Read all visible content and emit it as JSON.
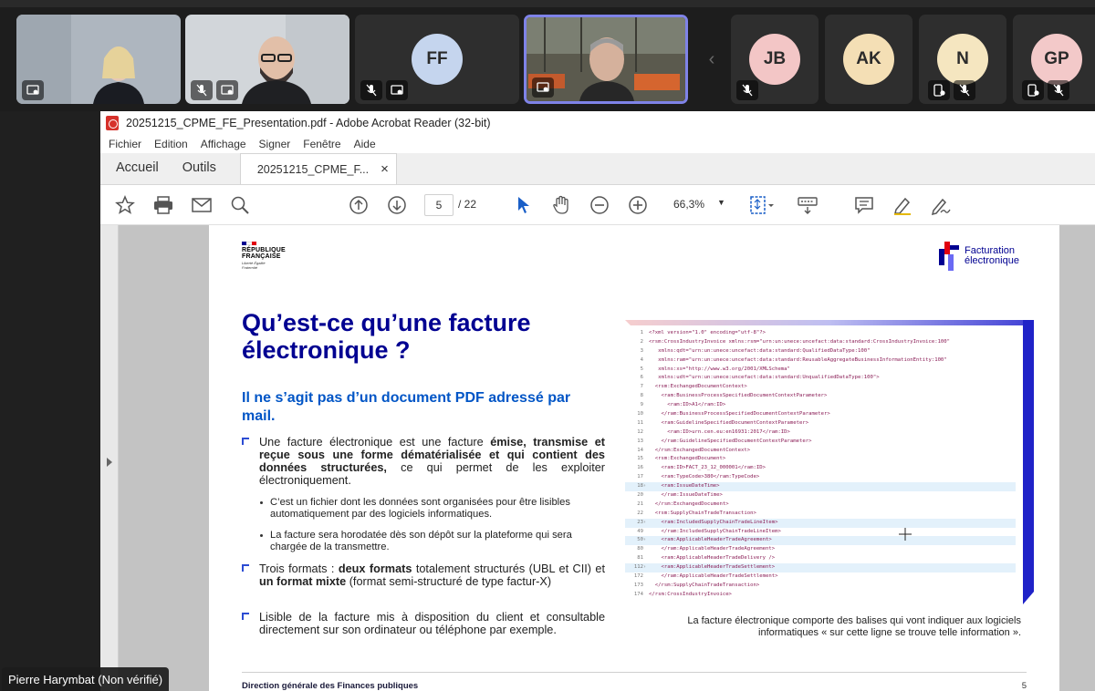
{
  "participants": [
    {
      "kind": "video",
      "label": "",
      "avatar_bg": "#b9c0c8"
    },
    {
      "kind": "video",
      "label": "",
      "avatar_bg": "#cfd3d8"
    },
    {
      "kind": "avatar",
      "label": "FF",
      "avatar_bg": "#c5d5ee"
    },
    {
      "kind": "video-active",
      "label": "",
      "avatar_bg": "#6b6250"
    },
    {
      "kind": "avatar",
      "label": "JB",
      "avatar_bg": "#f3c6c6"
    },
    {
      "kind": "avatar",
      "label": "AK",
      "avatar_bg": "#f4dfb5"
    },
    {
      "kind": "avatar",
      "label": "N",
      "avatar_bg": "#f5e6c0"
    },
    {
      "kind": "avatar",
      "label": "GP",
      "avatar_bg": "#f3c9c9"
    }
  ],
  "speaker_name": "Pierre Harymbat (Non vérifié)",
  "acrobat": {
    "window_title": "20251215_CPME_FE_Presentation.pdf - Adobe Acrobat Reader (32-bit)",
    "menu": [
      "Fichier",
      "Edition",
      "Affichage",
      "Signer",
      "Fenêtre",
      "Aide"
    ],
    "tabs": {
      "home": "Accueil",
      "tools": "Outils",
      "doc": "20251215_CPME_F...",
      "close": "×"
    },
    "page_current": "5",
    "page_total": "/ 22",
    "zoom": "66,3%"
  },
  "slide": {
    "header_left": {
      "line1": "RÉPUBLIQUE",
      "line2": "FRANÇAISE",
      "motto": "Liberté Égalité Fraternité"
    },
    "brand": {
      "line1": "Facturation",
      "line2": "électronique"
    },
    "title": "Qu’est-ce qu’une facture électronique ?",
    "subtitle": "Il ne s’agit pas d’un document PDF adressé par mail.",
    "bullet1_pre": "Une facture électronique est une facture ",
    "bullet1_bold": "émise, transmise et reçue sous une forme dématérialisée et qui contient des données structurées,",
    "bullet1_post": " ce qui permet de les exploiter électroniquement.",
    "sub1": "C’est un fichier dont les données sont organisées pour être lisibles automatiquement par des logiciels informatiques.",
    "sub2": "La facture sera horodatée dès son dépôt sur la plateforme qui sera chargée de la transmettre.",
    "bullet2_a": "Trois formats : ",
    "bullet2_b": "deux formats",
    "bullet2_c": " totalement structurés (UBL et CII) et ",
    "bullet2_d": "un format mixte",
    "bullet2_e": " (format semi-structuré de type factur-X)",
    "bullet3": "Lisible de la facture mis à disposition du client et consultable directement sur son ordinateur ou téléphone par exemple.",
    "caption": "La facture électronique comporte des balises qui vont indiquer aux logiciels informatiques « sur cette ligne se trouve telle information ».",
    "footer": "Direction générale des Finances publiques",
    "page_number": "5",
    "code": [
      {
        "n": "1",
        "t": "<?xml version=\"1.0\" encoding=\"utf-8\"?>"
      },
      {
        "n": "2",
        "t": "<rsm:CrossIndustryInvoice xmlns:rsm=\"urn:un:unece:uncefact:data:standard:CrossIndustryInvoice:100\""
      },
      {
        "n": "3",
        "t": "   xmlns:qdt=\"urn:un:unece:uncefact:data:standard:QualifiedDataType:100\""
      },
      {
        "n": "4",
        "t": "   xmlns:ram=\"urn:un:unece:uncefact:data:standard:ReusableAggregateBusinessInformationEntity:100\""
      },
      {
        "n": "5",
        "t": "   xmlns:xs=\"http://www.w3.org/2001/XMLSchema\""
      },
      {
        "n": "6",
        "t": "   xmlns:udt=\"urn:un:unece:uncefact:data:standard:UnqualifiedDataType:100\">"
      },
      {
        "n": "7",
        "t": "  <rsm:ExchangedDocumentContext>"
      },
      {
        "n": "8",
        "t": "    <ram:BusinessProcessSpecifiedDocumentContextParameter>"
      },
      {
        "n": "9",
        "t": "      <ram:ID>A1</ram:ID>"
      },
      {
        "n": "10",
        "t": "    </ram:BusinessProcessSpecifiedDocumentContextParameter>"
      },
      {
        "n": "11",
        "t": "    <ram:GuidelineSpecifiedDocumentContextParameter>"
      },
      {
        "n": "12",
        "t": "      <ram:ID>urn.cen.eu:en16931:2017</ram:ID>"
      },
      {
        "n": "13",
        "t": "    </ram:GuidelineSpecifiedDocumentContextParameter>"
      },
      {
        "n": "14",
        "t": "  </rsm:ExchangedDocumentContext>"
      },
      {
        "n": "15",
        "t": "  <rsm:ExchangedDocument>"
      },
      {
        "n": "16",
        "t": "    <ram:ID>FACT_23_12_000001</ram:ID>"
      },
      {
        "n": "17",
        "t": "    <ram:TypeCode>380</ram:TypeCode>"
      },
      {
        "n": "18",
        "t": "    <ram:IssueDateTime>",
        "hl": true
      },
      {
        "n": "20",
        "t": "    </ram:IssueDateTime>"
      },
      {
        "n": "21",
        "t": "  </rsm:ExchangedDocument>"
      },
      {
        "n": "22",
        "t": "  <rsm:SupplyChainTradeTransaction>"
      },
      {
        "n": "23",
        "t": "    <ram:IncludedSupplyChainTradeLineItem>",
        "hl": true
      },
      {
        "n": "49",
        "t": "    </ram:IncludedSupplyChainTradeLineItem>"
      },
      {
        "n": "50",
        "t": "    <ram:ApplicableHeaderTradeAgreement>",
        "hl": true
      },
      {
        "n": "80",
        "t": "    </ram:ApplicableHeaderTradeAgreement>"
      },
      {
        "n": "81",
        "t": "    <ram:ApplicableHeaderTradeDelivery />"
      },
      {
        "n": "112",
        "t": "    <ram:ApplicableHeaderTradeSettlement>",
        "hl": true
      },
      {
        "n": "172",
        "t": "    </ram:ApplicableHeaderTradeSettlement>"
      },
      {
        "n": "173",
        "t": "  </rsm:SupplyChainTradeTransaction>"
      },
      {
        "n": "174",
        "t": "</rsm:CrossIndustryInvoice>"
      }
    ]
  }
}
